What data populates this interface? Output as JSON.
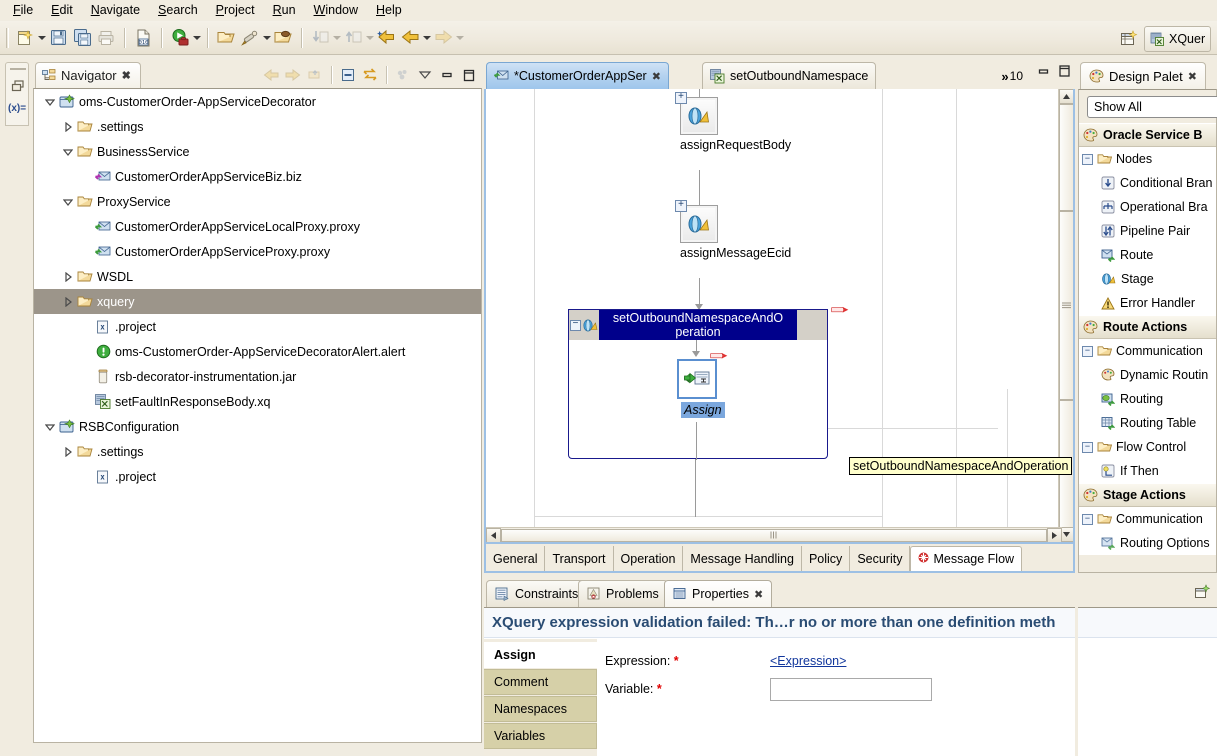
{
  "menubar": {
    "items": [
      {
        "label": "File",
        "accel": "F"
      },
      {
        "label": "Edit",
        "accel": "E"
      },
      {
        "label": "Navigate",
        "accel": "N"
      },
      {
        "label": "Search",
        "accel": "S"
      },
      {
        "label": "Project",
        "accel": "P"
      },
      {
        "label": "Run",
        "accel": "R"
      },
      {
        "label": "Window",
        "accel": "W"
      },
      {
        "label": "Help",
        "accel": "H"
      }
    ]
  },
  "toolbar": {
    "buttons": [
      {
        "name": "new-wizard",
        "tooltip": "New"
      },
      {
        "name": "save",
        "tooltip": "Save"
      },
      {
        "name": "save-all",
        "tooltip": "Save All"
      },
      {
        "name": "print",
        "tooltip": "Print"
      },
      {
        "name": "new-xquery",
        "tooltip": "New XQuery"
      },
      {
        "name": "run",
        "tooltip": "Run"
      },
      {
        "name": "open-resource",
        "tooltip": "Open Resource"
      },
      {
        "name": "search",
        "tooltip": "Search"
      },
      {
        "name": "open-task",
        "tooltip": "Open Task"
      },
      {
        "name": "next-annotation",
        "tooltip": "Next Annotation"
      },
      {
        "name": "previous-annotation",
        "tooltip": "Previous Annotation"
      },
      {
        "name": "last-edit-location",
        "tooltip": "Last Edit Location"
      },
      {
        "name": "back",
        "tooltip": "Back"
      },
      {
        "name": "forward",
        "tooltip": "Forward"
      }
    ]
  },
  "perspective": {
    "open_perspective_tooltip": "Open Perspective",
    "current": "XQuer"
  },
  "navigator": {
    "title": "Navigator",
    "toolbar": [
      "back-icon",
      "forward-icon",
      "up-icon",
      "collapse-all-icon",
      "link-with-editor-icon",
      "view-menu-icon",
      "minimize-icon",
      "maximize-icon"
    ],
    "tree": [
      {
        "label": "oms-CustomerOrder-AppServiceDecorator",
        "indent": 0,
        "twist": "expanded",
        "icon": "project-icon",
        "selected": false
      },
      {
        "label": ".settings",
        "indent": 1,
        "twist": "collapsed",
        "icon": "folder-icon",
        "selected": false
      },
      {
        "label": "BusinessService",
        "indent": 1,
        "twist": "expanded",
        "icon": "folder-icon",
        "selected": false
      },
      {
        "label": "CustomerOrderAppServiceBiz.biz",
        "indent": 2,
        "twist": "none",
        "icon": "biz-service-icon",
        "selected": false
      },
      {
        "label": "ProxyService",
        "indent": 1,
        "twist": "expanded",
        "icon": "folder-icon",
        "selected": false
      },
      {
        "label": "CustomerOrderAppServiceLocalProxy.proxy",
        "indent": 2,
        "twist": "none",
        "icon": "proxy-service-icon",
        "selected": false
      },
      {
        "label": "CustomerOrderAppServiceProxy.proxy",
        "indent": 2,
        "twist": "none",
        "icon": "proxy-service-icon",
        "selected": false
      },
      {
        "label": "WSDL",
        "indent": 1,
        "twist": "collapsed",
        "icon": "folder-icon",
        "selected": false
      },
      {
        "label": "xquery",
        "indent": 1,
        "twist": "collapsed",
        "icon": "folder-icon",
        "selected": true
      },
      {
        "label": ".project",
        "indent": 2,
        "twist": "none",
        "icon": "xml-file-icon",
        "selected": false
      },
      {
        "label": "oms-CustomerOrder-AppServiceDecoratorAlert.alert",
        "indent": 2,
        "twist": "none",
        "icon": "alert-icon",
        "selected": false
      },
      {
        "label": "rsb-decorator-instrumentation.jar",
        "indent": 2,
        "twist": "none",
        "icon": "jar-icon",
        "selected": false
      },
      {
        "label": "setFaultInResponseBody.xq",
        "indent": 2,
        "twist": "none",
        "icon": "xquery-file-icon",
        "selected": false
      },
      {
        "label": "RSBConfiguration",
        "indent": 0,
        "twist": "expanded",
        "icon": "project-icon",
        "selected": false
      },
      {
        "label": ".settings",
        "indent": 1,
        "twist": "collapsed",
        "icon": "folder-icon",
        "selected": false
      },
      {
        "label": ".project",
        "indent": 2,
        "twist": "none",
        "icon": "xml-file-icon",
        "selected": false
      }
    ]
  },
  "editor": {
    "tabs": [
      {
        "label": "*CustomerOrderAppSer",
        "icon": "proxy-service-icon",
        "active": true,
        "closeable": true
      },
      {
        "label": "setOutboundNamespace",
        "icon": "xquery-file-icon",
        "active": false,
        "closeable": false
      }
    ],
    "overflow_count": "10",
    "overflow_chevron": "»",
    "window_buttons": [
      "minimize-icon",
      "maximize-icon"
    ],
    "flow": {
      "nodes": [
        {
          "name": "assignRequestBody",
          "type": "stage",
          "expander": "+"
        },
        {
          "name": "assignMessageEcid",
          "type": "stage",
          "expander": "+"
        }
      ],
      "selected_stage": {
        "title": "setOutboundNamespaceAndOperation",
        "title_line1": "setOutboundNamespaceAndO",
        "title_line2": "peration",
        "expander": "−",
        "has_error": true,
        "child": {
          "label": "Assign",
          "type": "assign-action",
          "has_error": true,
          "selected": true
        }
      },
      "tooltip": "setOutboundNamespaceAndOperation"
    },
    "bottom_tabs": [
      {
        "label": "General",
        "active": false,
        "error": false
      },
      {
        "label": "Transport",
        "active": false,
        "error": false
      },
      {
        "label": "Operation",
        "active": false,
        "error": false
      },
      {
        "label": "Message Handling",
        "active": false,
        "error": false
      },
      {
        "label": "Policy",
        "active": false,
        "error": false
      },
      {
        "label": "Security",
        "active": false,
        "error": false
      },
      {
        "label": "Message Flow",
        "active": true,
        "error": true
      }
    ]
  },
  "bottom_panel": {
    "tabs": [
      {
        "label": "Constraints",
        "icon": "constraints-icon",
        "active": false,
        "closeable": false
      },
      {
        "label": "Problems",
        "icon": "problems-icon",
        "active": false,
        "closeable": false
      },
      {
        "label": "Properties",
        "icon": "properties-icon",
        "active": true,
        "closeable": true
      }
    ],
    "toolbar_icon": "restore-icon",
    "error_message": "XQuery expression validation failed: Th…r no or more than one definition meth",
    "property_tabs": [
      {
        "label": "Assign",
        "active": true
      },
      {
        "label": "Comment",
        "active": false
      },
      {
        "label": "Namespaces",
        "active": false
      },
      {
        "label": "Variables",
        "active": false
      }
    ],
    "form": {
      "expression_label": "Expression:",
      "expression_required": "*",
      "expression_link": "<Expression>",
      "variable_label": "Variable:",
      "variable_required": "*",
      "variable_value": ""
    }
  },
  "palette": {
    "title": "Design Palet",
    "filter_value": "Show All",
    "sections": [
      {
        "type": "group",
        "label": "Oracle Service B",
        "icon": "palette-icon"
      },
      {
        "type": "folder",
        "label": "Nodes",
        "state": "expanded",
        "items": [
          {
            "label": "Conditional Bran",
            "icon": "conditional-branch-icon"
          },
          {
            "label": "Operational Bra",
            "icon": "operational-branch-icon"
          },
          {
            "label": "Pipeline Pair",
            "icon": "pipeline-pair-icon"
          },
          {
            "label": "Route",
            "icon": "route-icon"
          },
          {
            "label": "Stage",
            "icon": "stage-icon"
          },
          {
            "label": "Error Handler",
            "icon": "error-handler-icon"
          }
        ]
      },
      {
        "type": "group",
        "label": "Route Actions",
        "icon": "palette-icon"
      },
      {
        "type": "folder",
        "label": "Communication",
        "state": "expanded",
        "items": [
          {
            "label": "Dynamic Routin",
            "icon": "dynamic-routing-icon"
          },
          {
            "label": "Routing",
            "icon": "routing-icon"
          },
          {
            "label": "Routing Table",
            "icon": "routing-table-icon"
          }
        ]
      },
      {
        "type": "folder",
        "label": "Flow Control",
        "state": "expanded",
        "items": [
          {
            "label": "If Then",
            "icon": "if-then-icon"
          }
        ]
      },
      {
        "type": "group",
        "label": "Stage Actions",
        "icon": "palette-icon"
      },
      {
        "type": "folder",
        "label": "Communication",
        "state": "expanded",
        "items": [
          {
            "label": "Routing Options",
            "icon": "routing-options-icon"
          }
        ]
      }
    ]
  },
  "colors": {
    "chrome": "#f1ece0",
    "selection": "#9c958a",
    "stage_title_bg": "#00008b",
    "tooltip_bg": "#ffffcc",
    "error_text": "#2a4c73",
    "required_marker": "#e00000",
    "link": "#11369c",
    "active_tab_blue": "#b4d2ef"
  }
}
